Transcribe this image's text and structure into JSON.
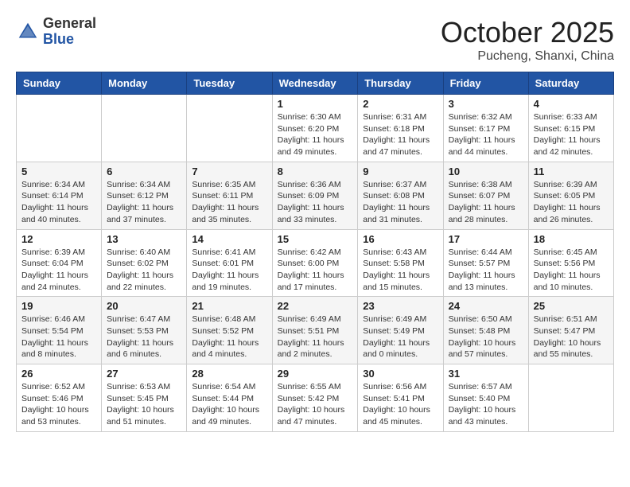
{
  "header": {
    "logo": {
      "general": "General",
      "blue": "Blue"
    },
    "month": "October 2025",
    "location": "Pucheng, Shanxi, China"
  },
  "weekdays": [
    "Sunday",
    "Monday",
    "Tuesday",
    "Wednesday",
    "Thursday",
    "Friday",
    "Saturday"
  ],
  "weeks": [
    [
      {
        "day": "",
        "info": ""
      },
      {
        "day": "",
        "info": ""
      },
      {
        "day": "",
        "info": ""
      },
      {
        "day": "1",
        "info": "Sunrise: 6:30 AM\nSunset: 6:20 PM\nDaylight: 11 hours\nand 49 minutes."
      },
      {
        "day": "2",
        "info": "Sunrise: 6:31 AM\nSunset: 6:18 PM\nDaylight: 11 hours\nand 47 minutes."
      },
      {
        "day": "3",
        "info": "Sunrise: 6:32 AM\nSunset: 6:17 PM\nDaylight: 11 hours\nand 44 minutes."
      },
      {
        "day": "4",
        "info": "Sunrise: 6:33 AM\nSunset: 6:15 PM\nDaylight: 11 hours\nand 42 minutes."
      }
    ],
    [
      {
        "day": "5",
        "info": "Sunrise: 6:34 AM\nSunset: 6:14 PM\nDaylight: 11 hours\nand 40 minutes."
      },
      {
        "day": "6",
        "info": "Sunrise: 6:34 AM\nSunset: 6:12 PM\nDaylight: 11 hours\nand 37 minutes."
      },
      {
        "day": "7",
        "info": "Sunrise: 6:35 AM\nSunset: 6:11 PM\nDaylight: 11 hours\nand 35 minutes."
      },
      {
        "day": "8",
        "info": "Sunrise: 6:36 AM\nSunset: 6:09 PM\nDaylight: 11 hours\nand 33 minutes."
      },
      {
        "day": "9",
        "info": "Sunrise: 6:37 AM\nSunset: 6:08 PM\nDaylight: 11 hours\nand 31 minutes."
      },
      {
        "day": "10",
        "info": "Sunrise: 6:38 AM\nSunset: 6:07 PM\nDaylight: 11 hours\nand 28 minutes."
      },
      {
        "day": "11",
        "info": "Sunrise: 6:39 AM\nSunset: 6:05 PM\nDaylight: 11 hours\nand 26 minutes."
      }
    ],
    [
      {
        "day": "12",
        "info": "Sunrise: 6:39 AM\nSunset: 6:04 PM\nDaylight: 11 hours\nand 24 minutes."
      },
      {
        "day": "13",
        "info": "Sunrise: 6:40 AM\nSunset: 6:02 PM\nDaylight: 11 hours\nand 22 minutes."
      },
      {
        "day": "14",
        "info": "Sunrise: 6:41 AM\nSunset: 6:01 PM\nDaylight: 11 hours\nand 19 minutes."
      },
      {
        "day": "15",
        "info": "Sunrise: 6:42 AM\nSunset: 6:00 PM\nDaylight: 11 hours\nand 17 minutes."
      },
      {
        "day": "16",
        "info": "Sunrise: 6:43 AM\nSunset: 5:58 PM\nDaylight: 11 hours\nand 15 minutes."
      },
      {
        "day": "17",
        "info": "Sunrise: 6:44 AM\nSunset: 5:57 PM\nDaylight: 11 hours\nand 13 minutes."
      },
      {
        "day": "18",
        "info": "Sunrise: 6:45 AM\nSunset: 5:56 PM\nDaylight: 11 hours\nand 10 minutes."
      }
    ],
    [
      {
        "day": "19",
        "info": "Sunrise: 6:46 AM\nSunset: 5:54 PM\nDaylight: 11 hours\nand 8 minutes."
      },
      {
        "day": "20",
        "info": "Sunrise: 6:47 AM\nSunset: 5:53 PM\nDaylight: 11 hours\nand 6 minutes."
      },
      {
        "day": "21",
        "info": "Sunrise: 6:48 AM\nSunset: 5:52 PM\nDaylight: 11 hours\nand 4 minutes."
      },
      {
        "day": "22",
        "info": "Sunrise: 6:49 AM\nSunset: 5:51 PM\nDaylight: 11 hours\nand 2 minutes."
      },
      {
        "day": "23",
        "info": "Sunrise: 6:49 AM\nSunset: 5:49 PM\nDaylight: 11 hours\nand 0 minutes."
      },
      {
        "day": "24",
        "info": "Sunrise: 6:50 AM\nSunset: 5:48 PM\nDaylight: 10 hours\nand 57 minutes."
      },
      {
        "day": "25",
        "info": "Sunrise: 6:51 AM\nSunset: 5:47 PM\nDaylight: 10 hours\nand 55 minutes."
      }
    ],
    [
      {
        "day": "26",
        "info": "Sunrise: 6:52 AM\nSunset: 5:46 PM\nDaylight: 10 hours\nand 53 minutes."
      },
      {
        "day": "27",
        "info": "Sunrise: 6:53 AM\nSunset: 5:45 PM\nDaylight: 10 hours\nand 51 minutes."
      },
      {
        "day": "28",
        "info": "Sunrise: 6:54 AM\nSunset: 5:44 PM\nDaylight: 10 hours\nand 49 minutes."
      },
      {
        "day": "29",
        "info": "Sunrise: 6:55 AM\nSunset: 5:42 PM\nDaylight: 10 hours\nand 47 minutes."
      },
      {
        "day": "30",
        "info": "Sunrise: 6:56 AM\nSunset: 5:41 PM\nDaylight: 10 hours\nand 45 minutes."
      },
      {
        "day": "31",
        "info": "Sunrise: 6:57 AM\nSunset: 5:40 PM\nDaylight: 10 hours\nand 43 minutes."
      },
      {
        "day": "",
        "info": ""
      }
    ]
  ]
}
